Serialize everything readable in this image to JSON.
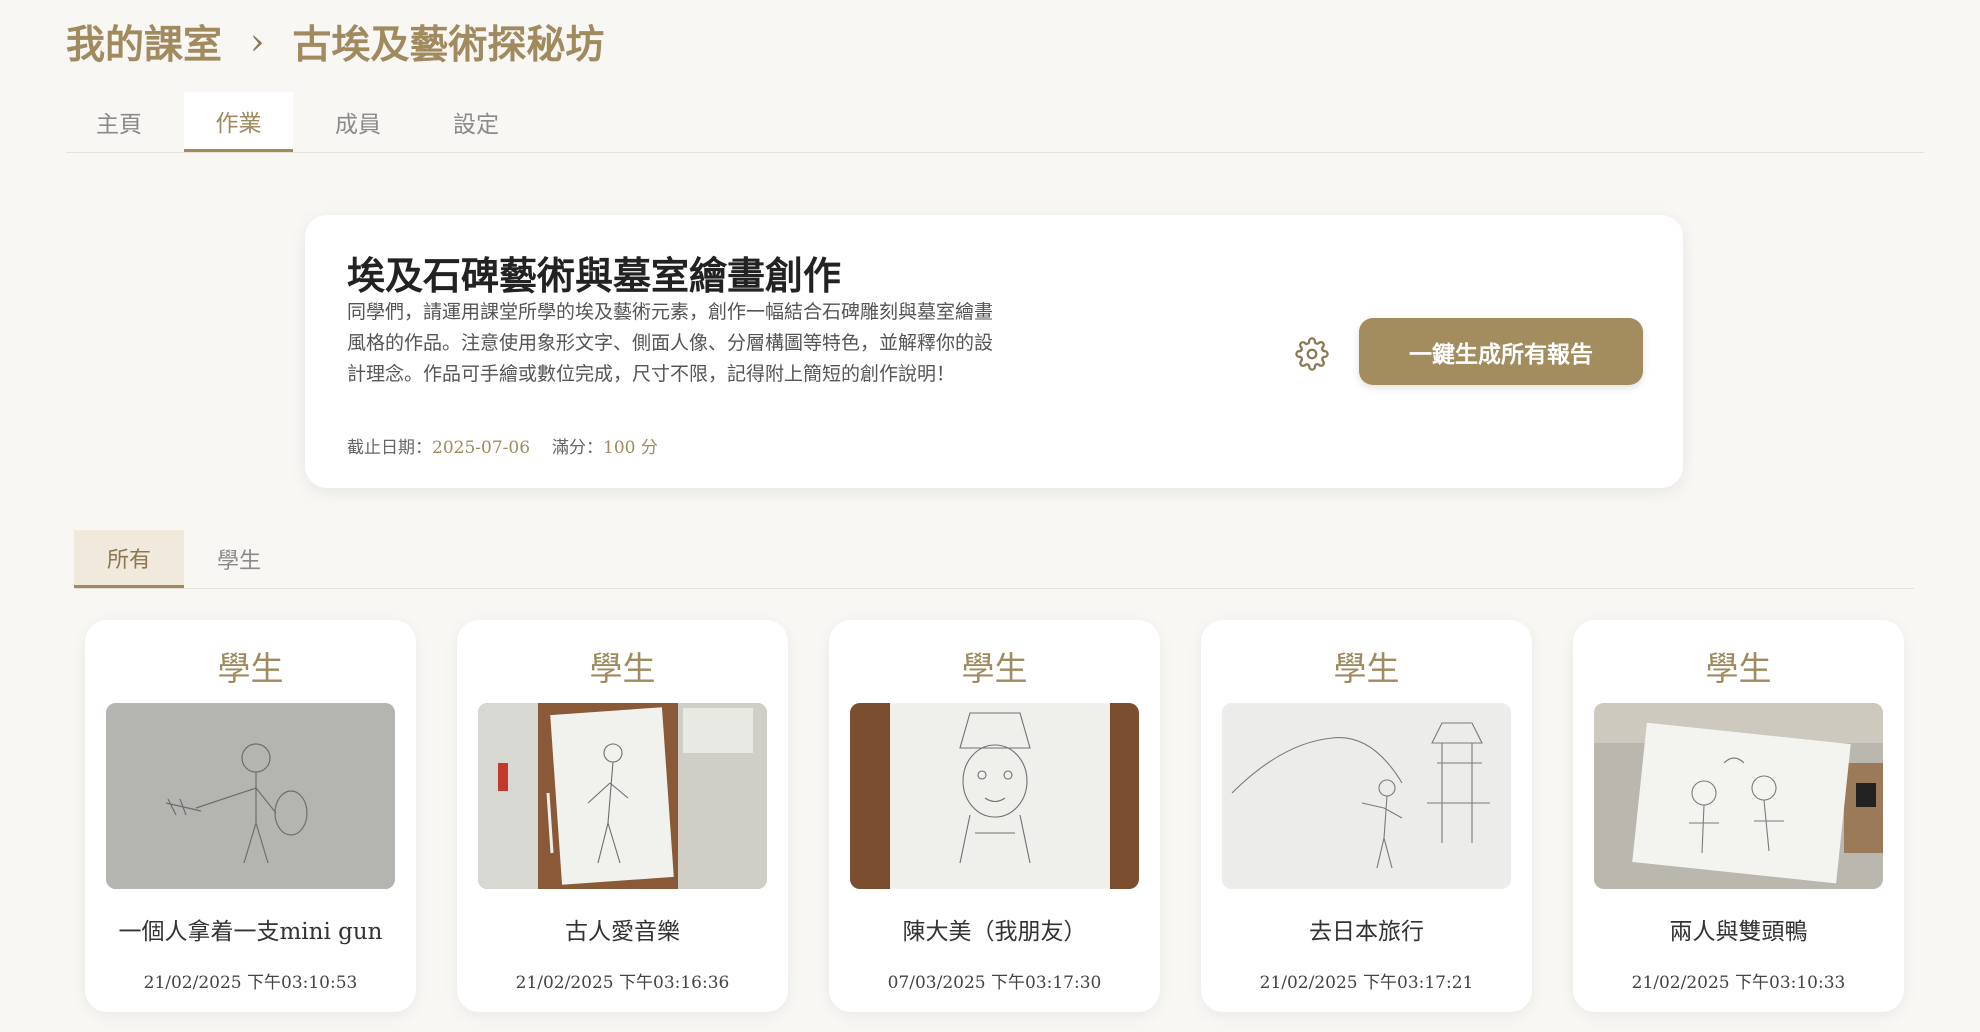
{
  "breadcrumb": {
    "root": "我的課室",
    "separator": "›",
    "current": "古埃及藝術探秘坊"
  },
  "tabs": [
    {
      "label": "主頁"
    },
    {
      "label": "作業",
      "active": true
    },
    {
      "label": "成員"
    },
    {
      "label": "設定"
    }
  ],
  "assignment": {
    "title": "埃及石碑藝術與墓室繪畫創作",
    "description": "同學們，請運用課堂所學的埃及藝術元素，創作一幅結合石碑雕刻與墓室繪畫風格的作品。注意使用象形文字、側面人像、分層構圖等特色，並解釋你的設計理念。作品可手繪或數位完成，尺寸不限，記得附上簡短的創作說明！",
    "due_label": "截止日期：",
    "due_date": "2025-07-06",
    "score_label": "滿分：",
    "score": "100 分",
    "settings_icon": "gear-icon",
    "generate_button": "一鍵生成所有報告"
  },
  "filter_tabs": [
    {
      "label": "所有",
      "active": true
    },
    {
      "label": "學生"
    }
  ],
  "submissions": [
    {
      "role": "學生",
      "title": "一個人拿着一支mini gun",
      "time": "21/02/2025 下午03:10:53"
    },
    {
      "role": "學生",
      "title": "古人愛音樂",
      "time": "21/02/2025 下午03:16:36"
    },
    {
      "role": "學生",
      "title": "陳大美（我朋友）",
      "time": "07/03/2025 下午03:17:30"
    },
    {
      "role": "學生",
      "title": "去日本旅行",
      "time": "21/02/2025 下午03:17:21"
    },
    {
      "role": "學生",
      "title": "兩人與雙頭鴨",
      "time": "21/02/2025 下午03:10:33"
    }
  ],
  "colors": {
    "accent": "#a08a5e",
    "button": "#a38c5d",
    "background": "#f8f7f4"
  }
}
